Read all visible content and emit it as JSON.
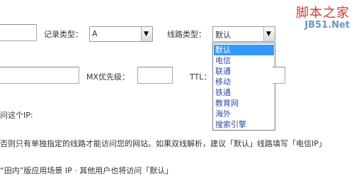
{
  "record_type": {
    "label": "记录类型：",
    "value": "A"
  },
  "line_type": {
    "label": "线路类型：",
    "value": "默认",
    "options": [
      "默认",
      "电信",
      "联通",
      "移动",
      "铁通",
      "教育网",
      "海外",
      "搜索引擎"
    ],
    "selected_index": 0
  },
  "mx_priority": {
    "label": "MX优先级：",
    "value": ""
  },
  "ttl": {
    "label": "TTL：",
    "value": ""
  },
  "text": {
    "line1": "问这个IP:",
    "line2": "否则只有单独指定的线路才能访问您的网站。如果双线解析，建议「默认」线路填写「电信IP」",
    "line3": "“田内”版应用场景 IP · 其他用户也将访问「默认」"
  },
  "watermark": {
    "title": "脚本之家",
    "url": "JB51.Net"
  },
  "colors": {
    "selected_bg": "#3399ff",
    "option_text": "#334aa8",
    "watermark_red": "#d03a32",
    "watermark_blue": "#6d95c2"
  }
}
